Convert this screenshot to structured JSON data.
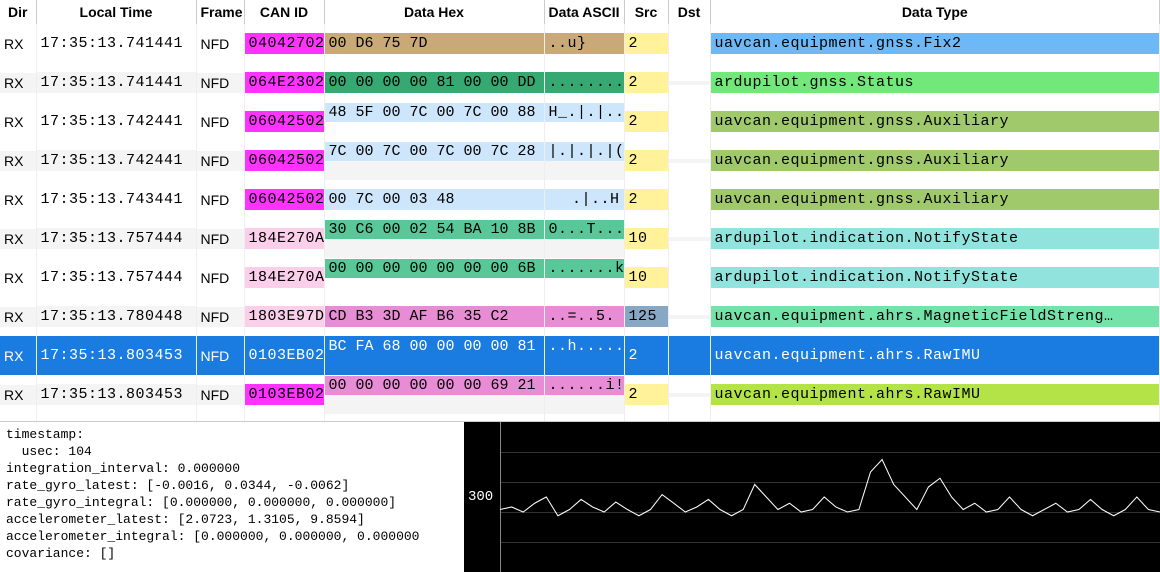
{
  "columns": {
    "dir": "Dir",
    "time": "Local Time",
    "frame": "Frame",
    "canid": "CAN ID",
    "hex": "Data Hex",
    "ascii": "Data ASCII",
    "src": "Src",
    "dst": "Dst",
    "type": "Data Type"
  },
  "rows": [
    {
      "dir": "RX",
      "time": "17:35:13.741441",
      "frame": "NFD",
      "canid": "04042702",
      "canid_bg": "#ff33ff",
      "hex": "00 D6 75 7D",
      "hex_bg": "#c9a977",
      "ascii": "..u}",
      "src": "2",
      "src_bg": "#fff29a",
      "type": "uavcan.equipment.gnss.Fix2",
      "type_bg": "#6db8f5",
      "split": false
    },
    {
      "dir": "RX",
      "time": "17:35:13.741441",
      "frame": "NFD",
      "canid": "064E2302",
      "canid_bg": "#ff33ff",
      "hex": "00 00 00 00 81 00 00 DD",
      "hex_bg": "#36a972",
      "ascii": "........",
      "src": "2",
      "src_bg": "#fff29a",
      "type": "ardupilot.gnss.Status",
      "type_bg": "#73e87a",
      "split": false,
      "alt": true
    },
    {
      "dir": "RX",
      "time": "17:35:13.742441",
      "frame": "NFD",
      "canid": "06042502",
      "canid_bg": "#ff33ff",
      "hex_top": "48 5F 00 7C 00 7C 00 88",
      "hex_bot": "",
      "hex_bg": "#cde6fb",
      "ascii": "H_.|.|..",
      "src": "2",
      "src_bg": "#fff29a",
      "type": "uavcan.equipment.gnss.Auxiliary",
      "type_bg": "#9fc96a",
      "split": true
    },
    {
      "dir": "RX",
      "time": "17:35:13.742441",
      "frame": "NFD",
      "canid": "06042502",
      "canid_bg": "#ff33ff",
      "hex_top": "7C 00 7C 00 7C 00 7C 28",
      "hex_bot": "",
      "hex_bg": "#cde6fb",
      "ascii": "|.|.|.|(",
      "src": "2",
      "src_bg": "#fff29a",
      "type": "uavcan.equipment.gnss.Auxiliary",
      "type_bg": "#9fc96a",
      "split": true,
      "alt": true
    },
    {
      "dir": "RX",
      "time": "17:35:13.743441",
      "frame": "NFD",
      "canid": "06042502",
      "canid_bg": "#ff33ff",
      "hex": "00 7C 00 03 48",
      "hex_bg": "#cde6fb",
      "ascii": ".|..H",
      "ascii_align": "right",
      "src": "2",
      "src_bg": "#fff29a",
      "type": "uavcan.equipment.gnss.Auxiliary",
      "type_bg": "#9fc96a",
      "split": false
    },
    {
      "dir": "RX",
      "time": "17:35:13.757444",
      "frame": "NFD",
      "canid": "184E270A",
      "canid_bg": "#fbcfea",
      "hex_top": "30 C6 00 02 54 BA 10 8B",
      "hex_bot": "",
      "hex_bg": "#58c898",
      "ascii": "0...T...",
      "src": "10",
      "src_bg": "#fff29a",
      "type": "ardupilot.indication.NotifyState",
      "type_bg": "#91e4de",
      "split": true,
      "alt": true
    },
    {
      "dir": "RX",
      "time": "17:35:13.757444",
      "frame": "NFD",
      "canid": "184E270A",
      "canid_bg": "#fbcfea",
      "hex_top": "00 00 00 00 00 00 00 6B",
      "hex_bot": "",
      "hex_bg": "#58c898",
      "ascii": ".......k",
      "src": "10",
      "src_bg": "#fff29a",
      "type": "ardupilot.indication.NotifyState",
      "type_bg": "#91e4de",
      "split": true
    },
    {
      "dir": "RX",
      "time": "17:35:13.780448",
      "frame": "NFD",
      "canid": "1803E97D",
      "canid_bg": "#fbcfea",
      "hex": "CD B3 3D AF B6 35 C2",
      "hex_bg": "#e98cd6",
      "ascii": "..=..5.",
      "src": "125",
      "src_bg": "#88a7c5",
      "type": "uavcan.equipment.ahrs.MagneticFieldStreng…",
      "type_bg": "#73e3a9",
      "split": false,
      "alt": true
    },
    {
      "dir": "RX",
      "time": "17:35:13.803453",
      "frame": "NFD",
      "canid": "0103EB02",
      "canid_bg": "#ff33ff",
      "hex_top": "BC FA 68 00 00 00 00 81",
      "hex_bot": "",
      "hex_bg": "#e98cd6",
      "ascii": "..h.....",
      "src": "2",
      "src_bg": "#fff29a",
      "type": "uavcan.equipment.ahrs.RawIMU",
      "type_bg": "#b3e347",
      "split": true,
      "selected": true
    },
    {
      "dir": "RX",
      "time": "17:35:13.803453",
      "frame": "NFD",
      "canid": "0103EB02",
      "canid_bg": "#ff33ff",
      "hex_top": "00 00 00 00 00 00 69 21",
      "hex_bot": "",
      "hex_bg": "#e98cd6",
      "ascii": "......i!",
      "src": "2",
      "src_bg": "#fff29a",
      "type": "uavcan.equipment.ahrs.RawIMU",
      "type_bg": "#b3e347",
      "split": true,
      "alt": true
    }
  ],
  "partial_row": {
    "hex": "",
    "hex_bg": "#e98cd6",
    "ascii": ""
  },
  "detail": "timestamp:\n  usec: 104\nintegration_interval: 0.000000\nrate_gyro_latest: [-0.0016, 0.0344, -0.0062]\nrate_gyro_integral: [0.000000, 0.000000, 0.000000]\naccelerometer_latest: [2.0723, 1.3105, 9.8594]\naccelerometer_integral: [0.000000, 0.000000, 0.000000\ncovariance: []",
  "plot": {
    "ylabel": "300"
  },
  "chart_data": {
    "type": "line",
    "title": "",
    "xlabel": "",
    "ylabel": "",
    "ylim": [
      250,
      370
    ],
    "series": [
      {
        "name": "value",
        "values": [
          300,
          302,
          298,
          305,
          310,
          295,
          300,
          308,
          302,
          298,
          306,
          300,
          295,
          300,
          312,
          305,
          298,
          302,
          308,
          300,
          295,
          300,
          320,
          310,
          300,
          305,
          298,
          300,
          310,
          302,
          298,
          300,
          330,
          340,
          320,
          310,
          300,
          318,
          325,
          310,
          300,
          305,
          298,
          300,
          310,
          300,
          295,
          300,
          305,
          298,
          300,
          308,
          300,
          295,
          300,
          310,
          300,
          298
        ]
      }
    ]
  }
}
